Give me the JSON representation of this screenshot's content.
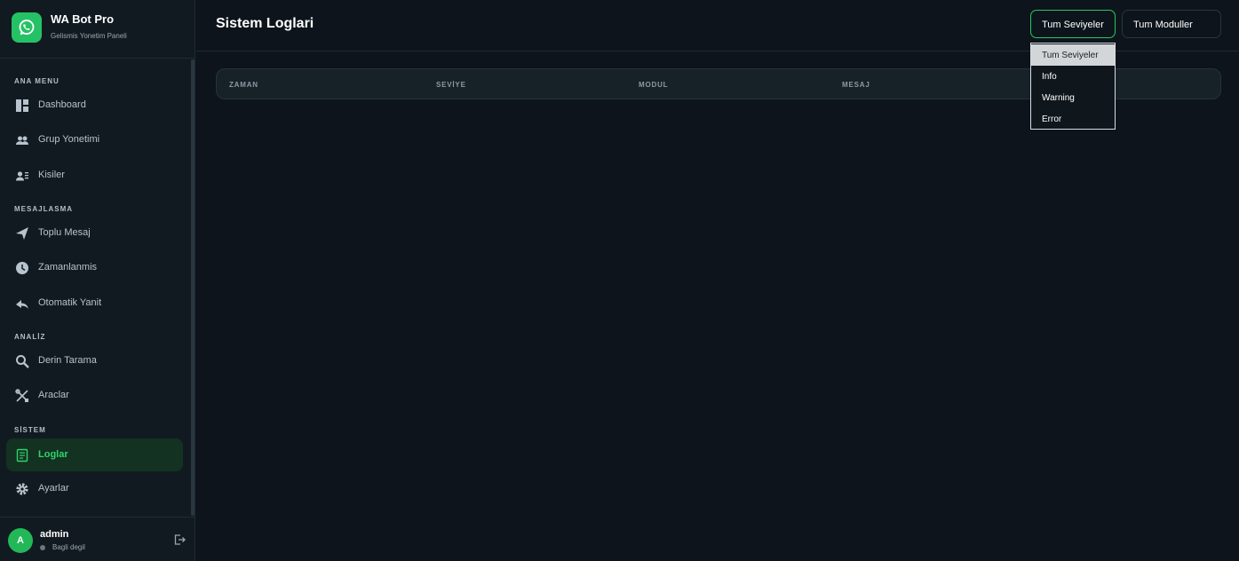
{
  "brand": {
    "title": "WA Bot Pro",
    "subtitle": "Gelismis Yonetim Paneli"
  },
  "sidebar": {
    "sections": [
      {
        "label": "ANA MENU"
      },
      {
        "label": "MESAJLASMA"
      },
      {
        "label": "ANALİZ"
      },
      {
        "label": "SİSTEM"
      }
    ],
    "items": [
      {
        "label": "Dashboard",
        "icon": "dashboard-icon"
      },
      {
        "label": "Grup Yonetimi",
        "icon": "group-icon"
      },
      {
        "label": "Kisiler",
        "icon": "contacts-icon"
      },
      {
        "label": "Toplu Mesaj",
        "icon": "send-icon"
      },
      {
        "label": "Zamanlanmis",
        "icon": "clock-icon"
      },
      {
        "label": "Otomatik Yanit",
        "icon": "reply-icon"
      },
      {
        "label": "Derin Tarama",
        "icon": "search-icon"
      },
      {
        "label": "Araclar",
        "icon": "tools-icon"
      },
      {
        "label": "Loglar",
        "icon": "log-icon",
        "active": true
      },
      {
        "label": "Ayarlar",
        "icon": "gear-icon"
      }
    ]
  },
  "user": {
    "initial": "A",
    "name": "admin",
    "status": "Bagli degil"
  },
  "header": {
    "title": "Sistem Loglari",
    "level_filter": "Tum Seviyeler",
    "module_filter": "Tum Moduller"
  },
  "table": {
    "columns": [
      "ZAMAN",
      "SEVİYE",
      "MODUL",
      "MESAJ"
    ]
  },
  "level_dropdown": {
    "options": [
      "Tum Seviyeler",
      "Info",
      "Warning",
      "Error"
    ],
    "selected": "Tum Seviyeler"
  },
  "colors": {
    "accent": "#25c265",
    "active_bg": "#133222",
    "background": "#0d141b"
  }
}
